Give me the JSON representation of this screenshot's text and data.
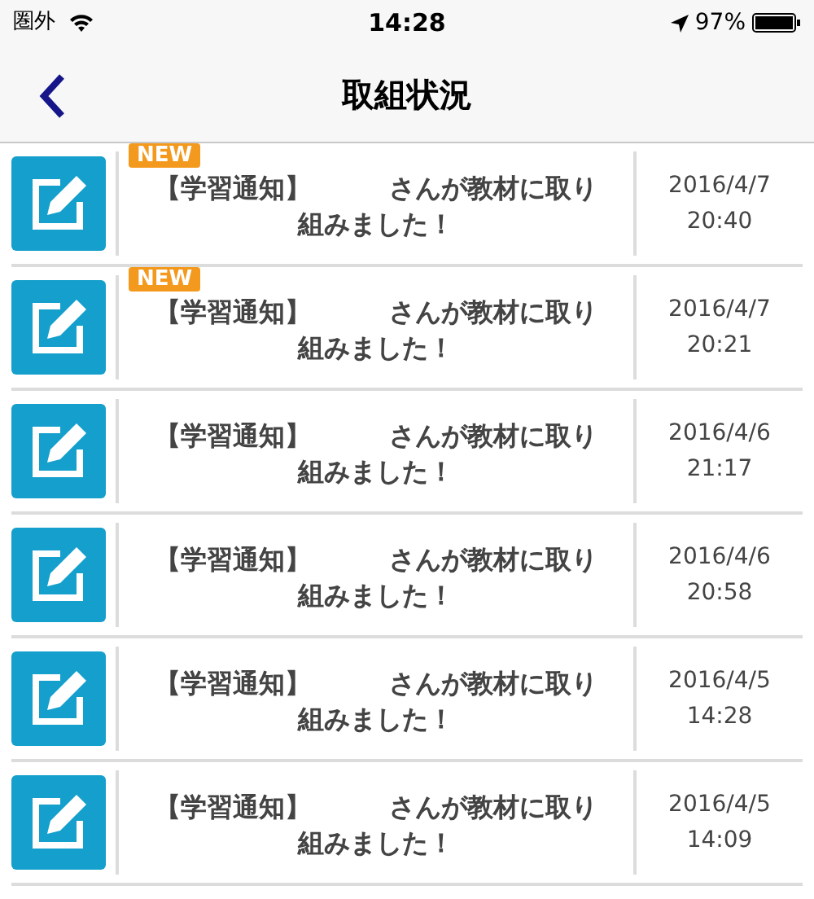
{
  "status_bar": {
    "carrier": "圏外",
    "time": "14:28",
    "battery": "97%"
  },
  "nav": {
    "title": "取組状況"
  },
  "items": [
    {
      "badge": "NEW",
      "message": "【学習通知】　　　さんが教材に取り組みました！",
      "date": "2016/4/7",
      "time": "20:40"
    },
    {
      "badge": "NEW",
      "message": "【学習通知】　　　さんが教材に取り組みました！",
      "date": "2016/4/7",
      "time": "20:21"
    },
    {
      "message": "【学習通知】　　　さんが教材に取り組みました！",
      "date": "2016/4/6",
      "time": "21:17"
    },
    {
      "message": "【学習通知】　　　さんが教材に取り組みました！",
      "date": "2016/4/6",
      "time": "20:58"
    },
    {
      "message": "【学習通知】　　　さんが教材に取り組みました！",
      "date": "2016/4/5",
      "time": "14:28"
    },
    {
      "message": "【学習通知】　　　さんが教材に取り組みました！",
      "date": "2016/4/5",
      "time": "14:09"
    }
  ]
}
